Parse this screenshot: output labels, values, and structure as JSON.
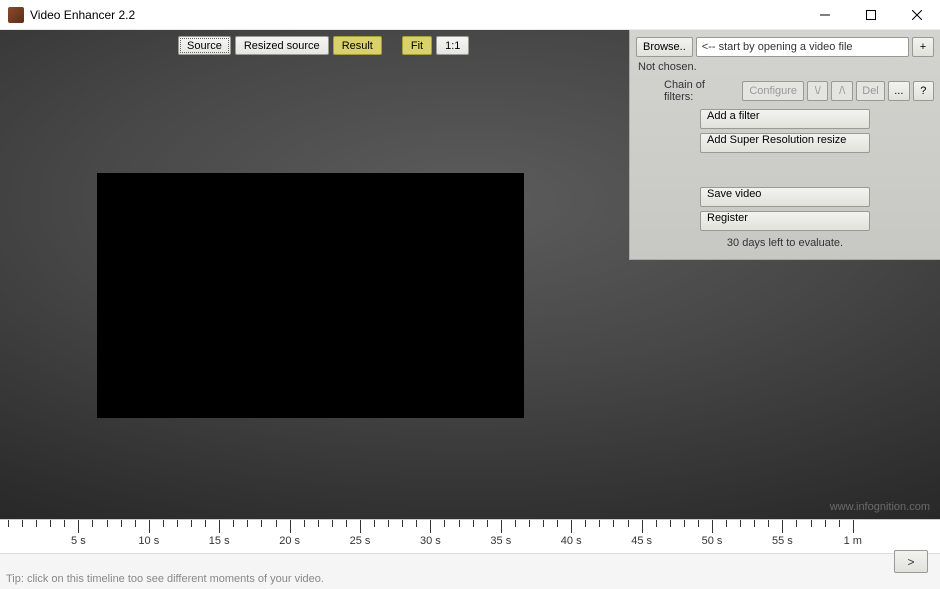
{
  "window": {
    "title": "Video Enhancer 2.2"
  },
  "view_toolbar": {
    "source": "Source",
    "resized": "Resized source",
    "result": "Result",
    "fit": "Fit",
    "oneToOne": "1:1"
  },
  "panel": {
    "browse": "Browse..",
    "file_hint": "<-- start by opening a video file",
    "plus": "+",
    "not_chosen": "Not chosen.",
    "chain_label": "Chain of filters:",
    "configure": "Configure",
    "down": "\\/",
    "up": "/\\",
    "del": "Del",
    "more": "...",
    "help": "?",
    "add_filter": "Add a filter",
    "add_sr": "Add Super Resolution resize",
    "save_video": "Save video",
    "register": "Register",
    "trial_note": "30 days left to evaluate."
  },
  "watermark": "www.infognition.com",
  "timeline": {
    "labels": [
      "5 s",
      "10 s",
      "15 s",
      "20 s",
      "25 s",
      "30 s",
      "35 s",
      "40 s",
      "45 s",
      "50 s",
      "55 s",
      "1 m"
    ],
    "tip": "Tip: click on this timeline too see different moments of your video.",
    "play": ">"
  }
}
